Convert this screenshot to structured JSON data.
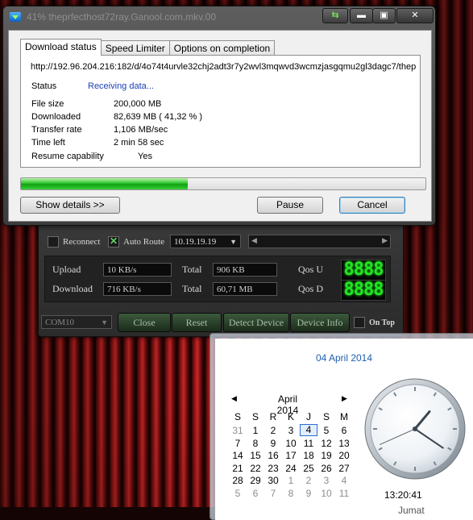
{
  "dialog": {
    "title": "41% theprfecthost72ray.Ganool.com.mkv.00",
    "tabs": [
      "Download status",
      "Speed Limiter",
      "Options on completion"
    ],
    "active_tab": 0,
    "url": "http://192.96.204.216:182/d/4o74t4urvle32chj2adt3r7y2wvl3mqwvd3wcmzjasgqmu2gl3dagc7/thepr",
    "status_label": "Status",
    "status_value": "Receiving data...",
    "fields": [
      {
        "label": "File size",
        "value": "200,000  MB"
      },
      {
        "label": "Downloaded",
        "value": "82,639  MB  ( 41,32 % )"
      },
      {
        "label": "Transfer rate",
        "value": "1,106  MB/sec"
      },
      {
        "label": "Time left",
        "value": "2 min 58 sec"
      },
      {
        "label": "Resume capability",
        "value": "Yes"
      }
    ],
    "progress_fraction": 0.4132,
    "buttons": {
      "show_details": "Show details >>",
      "pause": "Pause",
      "cancel": "Cancel"
    },
    "window_buttons": {
      "restore": "⇆",
      "minimize": "▬",
      "maximize": "▣",
      "close": "✕"
    }
  },
  "modem": {
    "reconnect_label": "Reconnect",
    "auto_route_label": "Auto Route",
    "ip_value": "10.19.19.19",
    "upload_label": "Upload",
    "upload_value": "10 KB/s",
    "upload_total_label": "Total",
    "upload_total": "906 KB",
    "qos_u_label": "Qos U",
    "qos_u_value": "8888",
    "download_label": "Download",
    "download_value": "716 KB/s",
    "download_total_label": "Total",
    "download_total": "60,71 MB",
    "qos_d_label": "Qos D",
    "qos_d_value": "8888",
    "port_value": "COM10",
    "close_label": "Close",
    "reset_label": "Reset",
    "detect_label": "Detect Device",
    "info_label": "Device Info",
    "ontop_label": "On Top",
    "accent": "#22e522"
  },
  "calendar": {
    "long_date": "04 April 2014",
    "month": "April 2014",
    "prev": "◀",
    "next": "▶",
    "weekdays": [
      "S",
      "S",
      "R",
      "K",
      "J",
      "S",
      "M"
    ],
    "weeks": [
      [
        "31",
        "1",
        "2",
        "3",
        "4",
        "5",
        "6"
      ],
      [
        "7",
        "8",
        "9",
        "10",
        "11",
        "12",
        "13"
      ],
      [
        "14",
        "15",
        "16",
        "17",
        "18",
        "19",
        "20"
      ],
      [
        "21",
        "22",
        "23",
        "24",
        "25",
        "26",
        "27"
      ],
      [
        "28",
        "29",
        "30",
        "1",
        "2",
        "3",
        "4"
      ],
      [
        "5",
        "6",
        "7",
        "8",
        "9",
        "10",
        "11"
      ]
    ],
    "today": "4",
    "time": "13:20:41",
    "day_name": "Jumat",
    "clock": {
      "hours": 13,
      "minutes": 20,
      "seconds": 41
    }
  }
}
